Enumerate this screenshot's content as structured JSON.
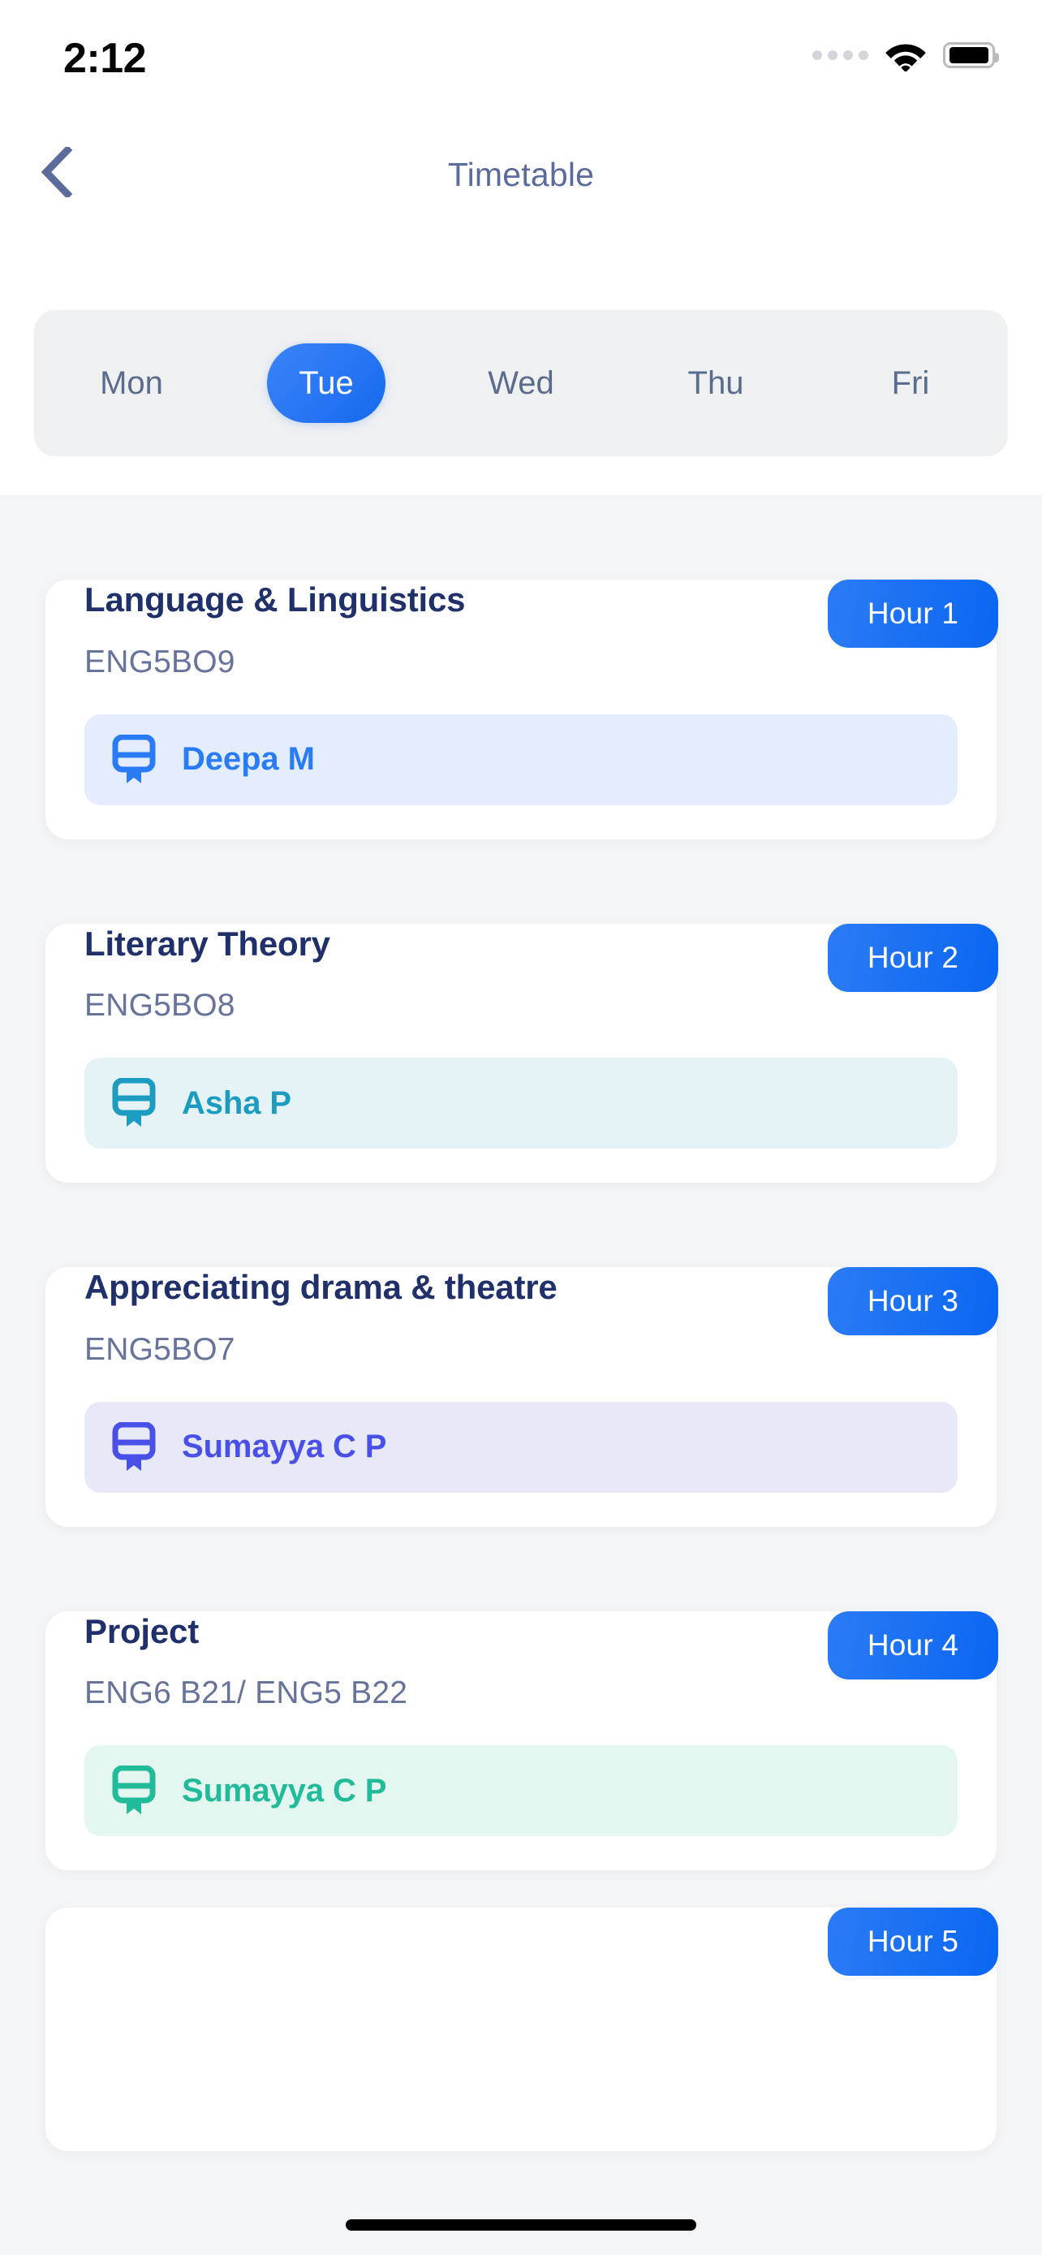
{
  "status_bar": {
    "time": "2:12",
    "cellular_icon": "signal-dots-icon",
    "wifi_icon": "wifi-icon",
    "battery_icon": "battery-full-icon"
  },
  "nav": {
    "back_icon": "chevron-left-icon",
    "title": "Timetable"
  },
  "day_tabs": {
    "selected": "Tue",
    "items": [
      {
        "label": "Mon",
        "active": false
      },
      {
        "label": "Tue",
        "active": true
      },
      {
        "label": "Wed",
        "active": false
      },
      {
        "label": "Thu",
        "active": false
      },
      {
        "label": "Fri",
        "active": false
      }
    ]
  },
  "colors": {
    "accent_blue": "#0a66f2",
    "title_navy": "#20306a",
    "code_grey": "#67739b",
    "page_bg": "#f4f5f7",
    "tabbar_bg": "#eff0f2"
  },
  "periods": [
    {
      "hour_label": "Hour 1",
      "subject": "Language & Linguistics",
      "code": "ENG5BO9",
      "teacher": "Deepa M",
      "teacher_icon": "lectern-icon",
      "chip_bg": "#e4edfd",
      "chip_fg": "#2a7cf6"
    },
    {
      "hour_label": "Hour 2",
      "subject": "Literary Theory",
      "code": "ENG5BO8",
      "teacher": "Asha P",
      "teacher_icon": "lectern-icon",
      "chip_bg": "#e5f3f6",
      "chip_fg": "#1b9cc0"
    },
    {
      "hour_label": "Hour 3",
      "subject": "Appreciating drama & theatre",
      "code": "ENG5BO7",
      "teacher": "Sumayya C P",
      "teacher_icon": "lectern-icon",
      "chip_bg": "#e8e9f8",
      "chip_fg": "#4950e8"
    },
    {
      "hour_label": "Hour 4",
      "subject": "Project",
      "code": "ENG6 B21/ ENG5 B22",
      "teacher": "Sumayya C P",
      "teacher_icon": "lectern-icon",
      "chip_bg": "#e4f6f0",
      "chip_fg": "#22bb9a"
    },
    {
      "hour_label": "Hour 5",
      "subject": "",
      "code": "",
      "teacher": "",
      "teacher_icon": "lectern-icon",
      "chip_bg": "#e4edfd",
      "chip_fg": "#2a7cf6"
    }
  ],
  "home_indicator": "home-indicator"
}
